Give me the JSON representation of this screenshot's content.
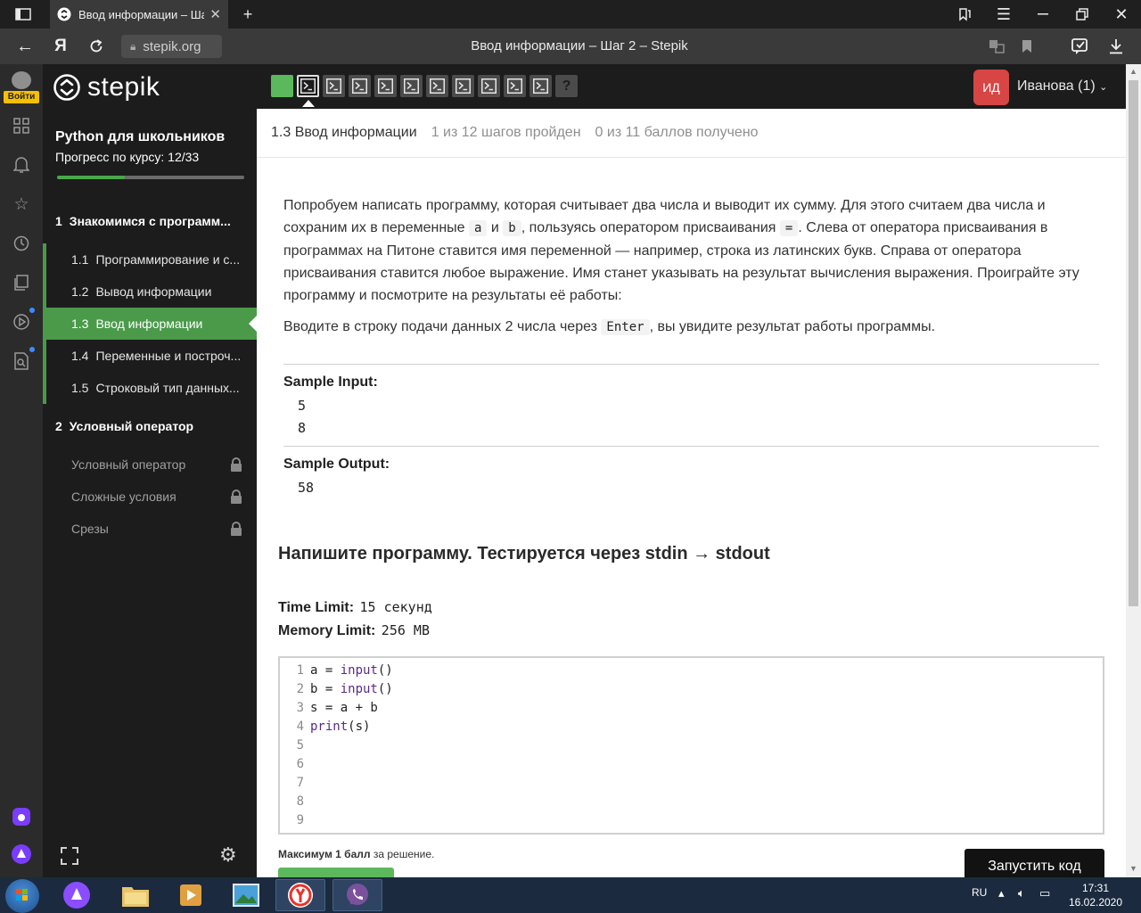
{
  "browser": {
    "tab_title": "Ввод информации – Ша",
    "url": "stepik.org",
    "page_title": "Ввод информации – Шаг 2 – Stepik",
    "yandex_letter": "Я"
  },
  "yandex_sidebar": {
    "login_label": "Войти"
  },
  "stepik": {
    "logo_text": "stepik",
    "course_title": "Python для школьников",
    "progress_label": "Прогресс по курсу:",
    "progress_value": "12/33",
    "progress_fraction": 0.364,
    "sections": [
      {
        "num": "1",
        "title": "Знакомимся с программ...",
        "lessons": [
          {
            "num": "1.1",
            "title": "Программирование и с..."
          },
          {
            "num": "1.2",
            "title": "Вывод информации"
          },
          {
            "num": "1.3",
            "title": "Ввод информации"
          },
          {
            "num": "1.4",
            "title": "Переменные и построч..."
          },
          {
            "num": "1.5",
            "title": "Строковый тип данных..."
          }
        ]
      },
      {
        "num": "2",
        "title": "Условный оператор",
        "lessons": [
          {
            "title": "Условный оператор"
          },
          {
            "title": "Сложные условия"
          },
          {
            "title": "Срезы"
          }
        ]
      }
    ],
    "steps": {
      "total": 12,
      "done_index": 0,
      "current_index": 1,
      "last_symbol": "?"
    },
    "user": {
      "initials": "ИД",
      "name": "Иванова (1)"
    }
  },
  "step": {
    "lesson_name": "1.3 Ввод информации",
    "steps_passed": "1 из 12 шагов пройден",
    "points": "0 из 11 баллов  получено",
    "intro": {
      "p1": "Попробуем написать программу, которая считывает два числа и выводит их сумму. Для этого считаем два числа и сохраним их в переменные ",
      "var_a": "a",
      "and": " и ",
      "var_b": "b",
      "p2": ", пользуясь оператором присваивания ",
      "op": "=",
      "p3": ". Слева от оператора присваивания в программах на Питоне ставится имя переменной — например, строка из латинских букв. Справа от оператора присваивания ставится любое выражение. Имя станет указывать на результат вычисления выражения. Проиграйте эту программу и посмотрите на результаты её работы:"
    },
    "hint": {
      "before": "Вводите в строку подачи данных 2 числа через ",
      "key": "Enter",
      "after": ", вы увидите результат работы программы."
    },
    "sample_input_label": "Sample Input:",
    "sample_input": [
      "5",
      "8"
    ],
    "sample_output_label": "Sample Output:",
    "sample_output": [
      "58"
    ],
    "task_title": "Напишите программу. Тестируется через stdin → stdout",
    "time_limit_label": "Time Limit:",
    "time_limit_value": "15 секунд",
    "memory_limit_label": "Memory Limit:",
    "memory_limit_value": "256 MB",
    "code_lines": [
      {
        "n": "1",
        "pre": "a = ",
        "fn": "input",
        "post": "()"
      },
      {
        "n": "2",
        "pre": "b = ",
        "fn": "input",
        "post": "()"
      },
      {
        "n": "3",
        "pre": "s = a + b",
        "fn": "",
        "post": ""
      },
      {
        "n": "4",
        "pre": "",
        "fn": "print",
        "post": "(s)"
      },
      {
        "n": "5",
        "pre": "",
        "fn": "",
        "post": ""
      },
      {
        "n": "6",
        "pre": "",
        "fn": "",
        "post": ""
      },
      {
        "n": "7",
        "pre": "",
        "fn": "",
        "post": ""
      },
      {
        "n": "8",
        "pre": "",
        "fn": "",
        "post": ""
      },
      {
        "n": "9",
        "pre": "",
        "fn": "",
        "post": ""
      }
    ],
    "max_points_bold": "Максимум 1 балл",
    "max_points_rest": " за решение.",
    "run_button": "Запустить код"
  },
  "taskbar": {
    "lang": "RU",
    "time": "17:31",
    "date": "16.02.2020",
    "apps": [
      "alice-icon",
      "explorer-icon",
      "media-player-icon",
      "photo-viewer-icon",
      "yandex-browser-icon",
      "viber-icon"
    ]
  },
  "colors": {
    "accent_green": "#5cb85c",
    "nav_green": "#4a9a4a",
    "avatar_red": "#d74545",
    "dark": "#1c1c1c"
  }
}
